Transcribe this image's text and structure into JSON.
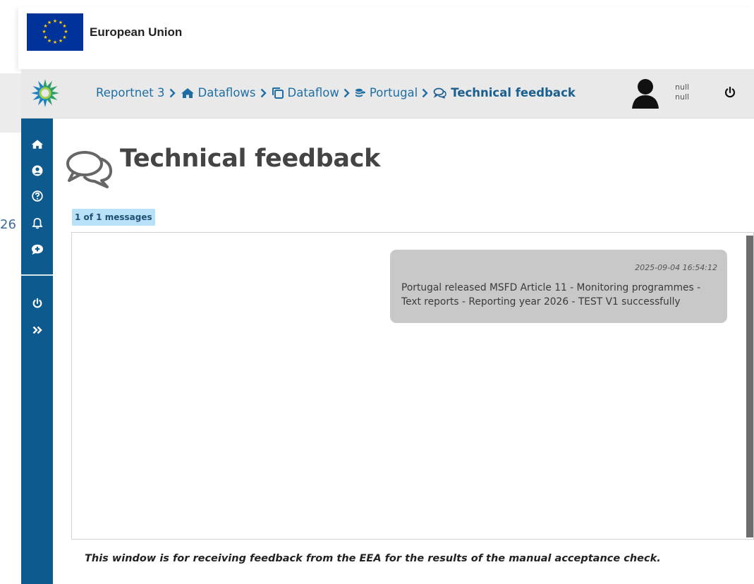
{
  "eu_header": {
    "title": "European Union",
    "flag_icon": "eu-flag-icon"
  },
  "background": {
    "fragment_text": "26"
  },
  "breadcrumb": [
    {
      "label": "Reportnet 3",
      "icon": null
    },
    {
      "label": "Dataflows",
      "icon": "home-icon"
    },
    {
      "label": "Dataflow",
      "icon": "clone-icon"
    },
    {
      "label": "Portugal",
      "icon": "coins-icon"
    },
    {
      "label": "Technical feedback",
      "icon": "comments-icon",
      "active": true
    }
  ],
  "user": {
    "line1": "null",
    "line2": "null"
  },
  "sidebar": {
    "items": [
      "home-icon",
      "user-circle-icon",
      "help-icon",
      "bell-icon",
      "comment-plus-icon",
      "power-icon",
      "expand-icon"
    ]
  },
  "page": {
    "title": "Technical feedback",
    "messages_count": "1 of 1 messages",
    "footer_note": "This window is for receiving feedback from the EEA for the results of the manual acceptance check."
  },
  "messages": [
    {
      "timestamp": "2025-09-04 16:54:12",
      "text": "Portugal released MSFD Article 11 - Monitoring programmes - Text reports - Reporting year 2026 - TEST V1 successfully"
    }
  ],
  "colors": {
    "sidebar": "#0c5a8e",
    "breadcrumb_link": "#1f6ea3",
    "badge_bg": "#b8e1f7",
    "message_bg": "#c8c8c8",
    "eu_blue": "#003399",
    "eu_gold": "#ffcc00"
  }
}
